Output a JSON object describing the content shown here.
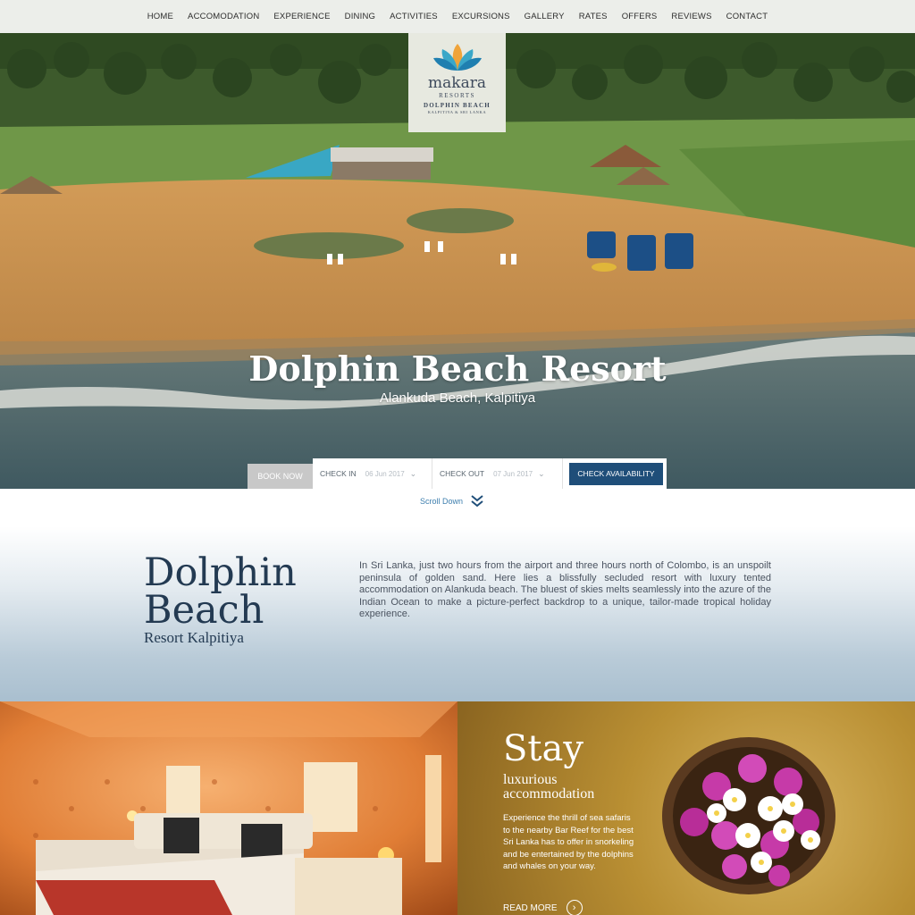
{
  "nav": {
    "items": [
      "HOME",
      "ACCOMODATION",
      "EXPERIENCE",
      "DINING",
      "ACTIVITIES",
      "EXCURSIONS",
      "GALLERY",
      "RATES",
      "OFFERS",
      "REVIEWS",
      "CONTACT"
    ]
  },
  "logo": {
    "brand": "makara",
    "line1": "RESORTS",
    "line2": "DOLPHIN BEACH",
    "line3": "KALPITIYA & SRI LANKA"
  },
  "hero": {
    "title": "Dolphin Beach Resort",
    "subtitle": "Alankuda Beach, Kalpitiya"
  },
  "booking": {
    "book_now": "BOOK NOW",
    "check_in_label": "CHECK IN",
    "check_in_value": "06 Jun 2017",
    "check_out_label": "CHECK OUT",
    "check_out_value": "07 Jun 2017",
    "check_availability": "CHECK AVAILABILITY"
  },
  "scroll": {
    "label": "Scroll Down"
  },
  "intro": {
    "title_line1": "Dolphin",
    "title_line2": "Beach",
    "subtitle": "Resort Kalpitiya",
    "text": "In Sri Lanka, just two hours from the airport and three hours north of Colombo, is an unspoilt peninsula of golden sand. Here lies a blissfully secluded resort with luxury tented accommodation on Alankuda beach. The bluest of skies melts seamlessly into the azure of the Indian Ocean to make a picture-perfect backdrop to a unique, tailor-made tropical holiday experience."
  },
  "stay": {
    "title": "Stay",
    "sub_line1": "luxurious",
    "sub_line2": "accommodation",
    "text": "Experience the thrill of sea safaris to the nearby Bar Reef for the best Sri Lanka has to offer in snorkeling and be entertained by the dolphins and whales on your way.",
    "read_more": "READ MORE"
  },
  "colors": {
    "primary": "#1f4e79",
    "nav_bg": "#eceeea",
    "sand": "#c9934f",
    "sea": "#4f6a72",
    "gold": "#b98f33"
  },
  "icons": [
    "lotus-logo-icon",
    "chevron-down-icon",
    "double-chevron-down-icon",
    "arrow-right-circle-icon"
  ]
}
